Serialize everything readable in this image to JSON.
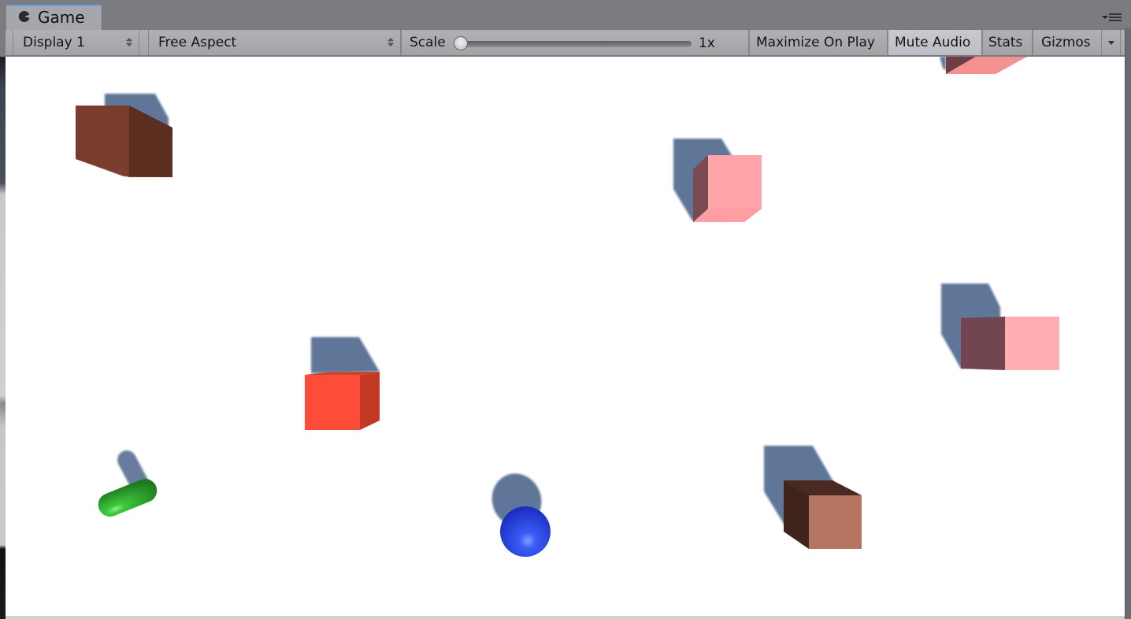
{
  "window": {
    "tab": {
      "label": "Game",
      "icon": "pacman-game-icon",
      "active": true
    },
    "panel_menu_icon": "panel-options-menu-icon"
  },
  "toolbar": {
    "display": {
      "label": "Display 1",
      "icon": "up-down-arrows-icon"
    },
    "aspect": {
      "label": "Free Aspect",
      "icon": "up-down-arrows-icon"
    },
    "scale": {
      "label": "Scale",
      "value_label": "1x",
      "value": 1,
      "slider_position_fraction": 0.0
    },
    "maximize_on_play": {
      "label": "Maximize On Play",
      "active": false
    },
    "mute_audio": {
      "label": "Mute Audio",
      "active": true
    },
    "stats": {
      "label": "Stats",
      "active": false
    },
    "gizmos": {
      "label": "Gizmos",
      "dropdown_icon": "dropdown-triangle-icon"
    }
  },
  "scene": {
    "background": "#ffffff",
    "shadow_color": "#5e7699",
    "objects": [
      {
        "name": "brown-box",
        "type": "cube",
        "front": "#7a3c2c",
        "side": "#5c2e1f",
        "bottom": "#8a4634"
      },
      {
        "name": "pink-cube-top-center",
        "type": "cube",
        "front": "#ffa4a8",
        "side": "#7a4a52",
        "bottom": "#ff9ea2"
      },
      {
        "name": "pink-cube-top-right-partial",
        "type": "cube",
        "front": "#f59190",
        "side": "#6e3e46"
      },
      {
        "name": "pink-cube-right",
        "type": "cube",
        "front": "#ffacb2",
        "side": "#724650"
      },
      {
        "name": "red-cube",
        "type": "cube",
        "front": "#fd4d39",
        "side": "#c43826",
        "top": "#c94530"
      },
      {
        "name": "green-capsule",
        "type": "capsule",
        "color": "#2fae2f"
      },
      {
        "name": "blue-sphere",
        "type": "sphere",
        "color": "#2244e8"
      },
      {
        "name": "tan-cube",
        "type": "cube",
        "front": "#b47660",
        "side": "#40231b",
        "top": "#4a2a20"
      }
    ]
  }
}
